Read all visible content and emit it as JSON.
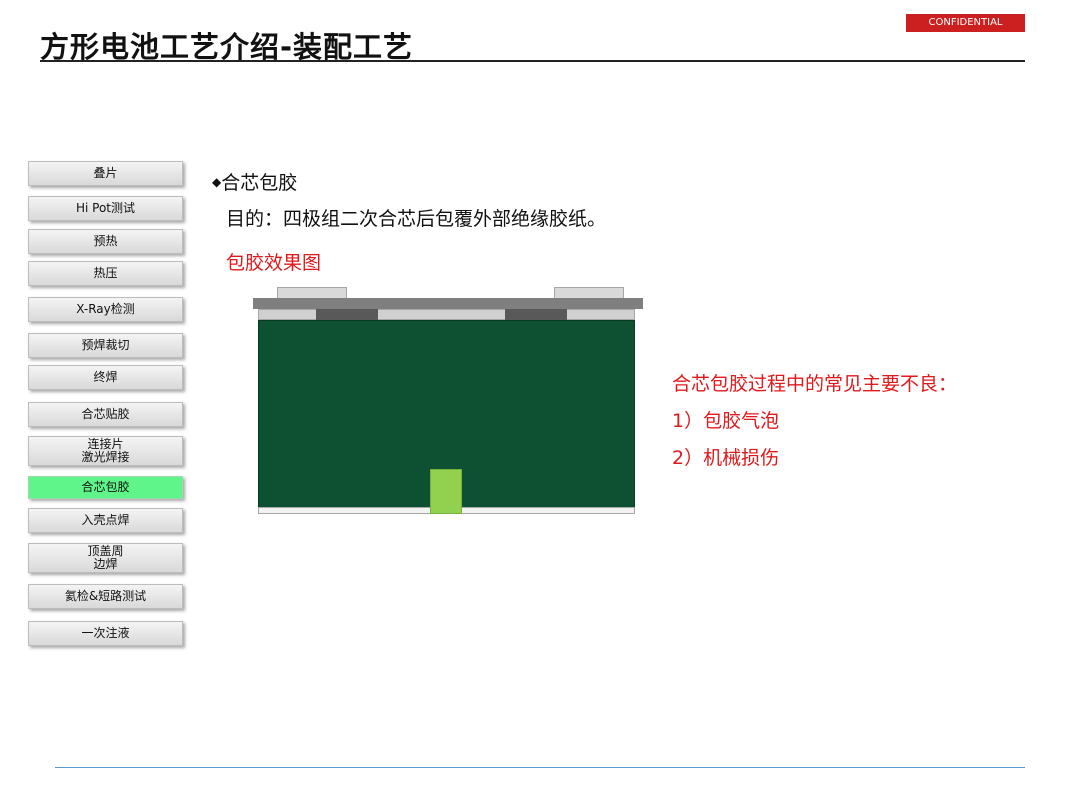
{
  "header": {
    "title": "方形电池工艺介绍-装配工艺",
    "confidential": "CONFIDENTIAL"
  },
  "sidebar": {
    "steps": [
      {
        "label": "叠片",
        "active": false
      },
      {
        "label": "Hi Pot测试",
        "active": false
      },
      {
        "label": "预热",
        "active": false
      },
      {
        "label": "热压",
        "active": false
      },
      {
        "label": "X-Ray检测",
        "active": false
      },
      {
        "label": "预焊裁切",
        "active": false
      },
      {
        "label": "终焊",
        "active": false
      },
      {
        "label": "合芯贴胶",
        "active": false
      },
      {
        "label": "连接片\n激光焊接",
        "active": false
      },
      {
        "label": "合芯包胶",
        "active": true
      },
      {
        "label": "入壳点焊",
        "active": false
      },
      {
        "label": "顶盖周\n边焊",
        "active": false
      },
      {
        "label": "氦检&短路测试",
        "active": false
      },
      {
        "label": "一次注液",
        "active": false
      }
    ]
  },
  "main": {
    "heading": "合芯包胶",
    "purpose": "目的：四极组二次合芯后包覆外部绝缘胶纸。",
    "diagram_label": "包胶效果图",
    "defects_title": "合芯包胶过程中的常见主要不良：",
    "defects": [
      "1）包胶气泡",
      "2）机械损伤"
    ]
  },
  "colors": {
    "accent_red": "#e0191c",
    "active_step": "#5ff58a",
    "cell_body": "#0d5132",
    "tab_green": "#92d050",
    "cover_plate": "#7f7f7f"
  }
}
